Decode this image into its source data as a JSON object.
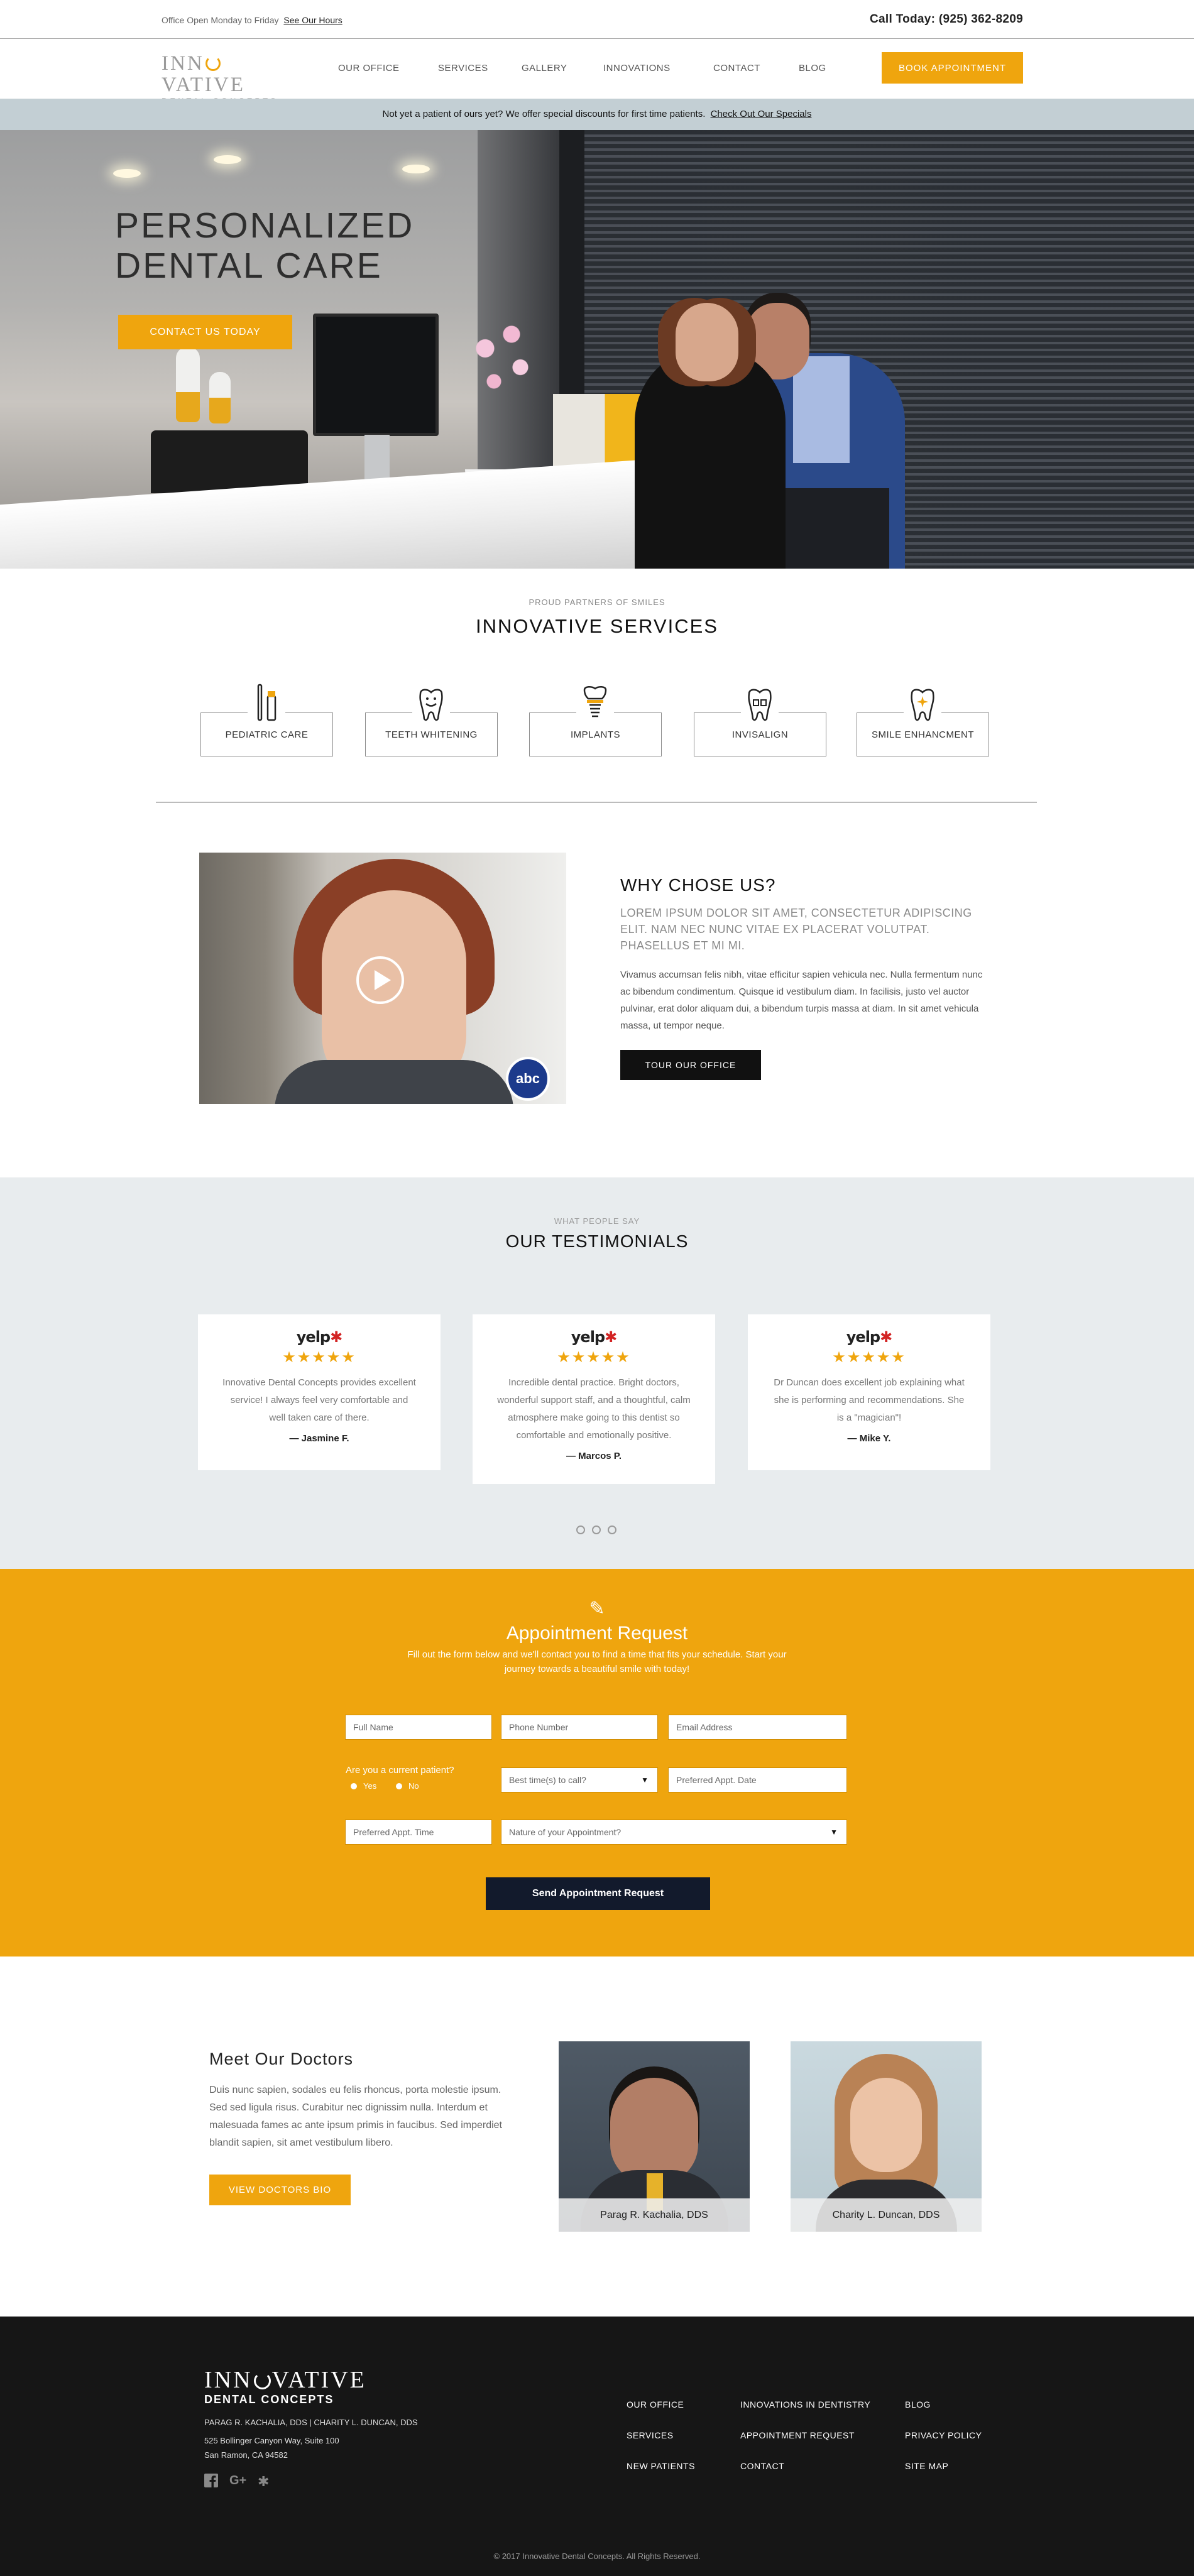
{
  "topbar": {
    "hours_text": "Office Open Monday to Friday",
    "hours_link": "See Our Hours",
    "phone": "Call Today: (925) 362-8209"
  },
  "nav": {
    "logo_line1_a": "INN",
    "logo_line1_b": "VATIVE",
    "logo_line2": "DENTAL CONCEPTS",
    "items": [
      "OUR OFFICE",
      "SERVICES",
      "GALLERY",
      "INNOVATIONS",
      "CONTACT",
      "BLOG"
    ],
    "book_button": "BOOK APPOINTMENT"
  },
  "special": {
    "text": "Not yet a patient of ours yet? We offer special discounts for first time patients.",
    "link": "Check Out Our Specials"
  },
  "hero": {
    "title_line1": "PERSONALIZED",
    "title_line2": "DENTAL CARE",
    "button": "CONTACT US TODAY"
  },
  "services": {
    "eyebrow": "PROUD PARTNERS OF SMILES",
    "title": "INNOVATIVE SERVICES",
    "items": [
      {
        "label": "PEDIATRIC CARE",
        "icon": "toothbrush-icon"
      },
      {
        "label": "TEETH WHITENING",
        "icon": "smiling-tooth-icon"
      },
      {
        "label": "IMPLANTS",
        "icon": "tooth-implant-icon"
      },
      {
        "label": "INVISALIGN",
        "icon": "tooth-aligner-icon"
      },
      {
        "label": "SMILE ENHANCMENT",
        "icon": "sparkle-tooth-icon"
      }
    ]
  },
  "why": {
    "title": "WHY CHOSE US?",
    "lead": "LOREM IPSUM DOLOR SIT AMET, CONSECTETUR ADIPISCING ELIT. NAM NEC NUNC VITAE EX PLACERAT VOLUTPAT. PHASELLUS ET MI MI.",
    "body": "Vivamus accumsan felis nibh, vitae efficitur sapien vehicula nec. Nulla fermentum nunc ac bibendum condimentum. Quisque id vestibulum diam. In facilisis, justo vel auctor pulvinar, erat dolor aliquam dui, a bibendum turpis massa at diam. In sit amet vehicula massa, ut tempor neque.",
    "button": "TOUR OUR OFFICE",
    "video_badge": "abc"
  },
  "testimonials": {
    "eyebrow": "WHAT PEOPLE SAY",
    "title": "OUR TESTIMONIALS",
    "yelp_text": "yelp",
    "stars": "★★★★★",
    "items": [
      {
        "quote": "Innovative Dental Concepts provides excellent service! I always feel very comfortable and well taken care of there.",
        "author": "— Jasmine F."
      },
      {
        "quote": "Incredible dental practice. Bright doctors, wonderful support staff, and a thoughtful, calm atmosphere make going to this dentist so comfortable and emotionally positive.",
        "author": "— Marcos P."
      },
      {
        "quote": "Dr Duncan does excellent job explaining what she is performing and recommendations. She is a \"magician\"!",
        "author": "— Mike Y."
      }
    ],
    "slide_count": 3
  },
  "appointment": {
    "title": "Appointment Request",
    "subtitle": "Fill out the form below and we'll contact you to find a time that fits your schedule. Start your journey towards a beautiful smile with today!",
    "placeholders": {
      "full_name": "Full Name",
      "phone": "Phone Number",
      "email": "Email Address",
      "best_time": "Best time(s) to call?",
      "appt_date": "Preferred Appt. Date",
      "appt_time": "Preferred Appt. Time",
      "nature": "Nature of your Appointment?"
    },
    "current_patient_question": "Are you a current patient?",
    "radio_yes": "Yes",
    "radio_no": "No",
    "submit": "Send Appointment Request"
  },
  "doctors": {
    "title": "Meet Our Doctors",
    "body": "Duis nunc sapien, sodales eu felis rhoncus, porta molestie ipsum. Sed sed ligula risus. Curabitur nec dignissim nulla. Interdum et malesuada fames ac ante ipsum primis in faucibus. Sed imperdiet blandit sapien, sit amet vestibulum libero.",
    "button": "VIEW DOCTORS BIO",
    "people": [
      "Parag R. Kachalia, DDS",
      "Charity L. Duncan, DDS"
    ]
  },
  "footer": {
    "logo_line1_a": "INN",
    "logo_line1_b": "VATIVE",
    "logo_line2": "DENTAL CONCEPTS",
    "doctors_line": "PARAG R. KACHALIA, DDS | CHARITY L. DUNCAN, DDS",
    "address1": "525 Bollinger Canyon Way, Suite 100",
    "address2": "San Ramon, CA 94582",
    "social": [
      "facebook-icon",
      "google-plus-icon",
      "yelp-icon"
    ],
    "links_col1": [
      "OUR OFFICE",
      "SERVICES",
      "NEW PATIENTS"
    ],
    "links_col2": [
      "INNOVATIONS IN DENTISTRY",
      "APPOINTMENT REQUEST",
      "CONTACT"
    ],
    "links_col3": [
      "BLOG",
      "PRIVACY POLICY",
      "SITE MAP"
    ],
    "copyright": "© 2017 Innovative Dental Concepts. All Rights Reserved."
  },
  "colors": {
    "accent": "#efa50e",
    "special_band": "#c3cfd4",
    "testimonials_bg": "#e8ecee",
    "footer_bg": "#161616",
    "submit_button": "#121a2c"
  }
}
